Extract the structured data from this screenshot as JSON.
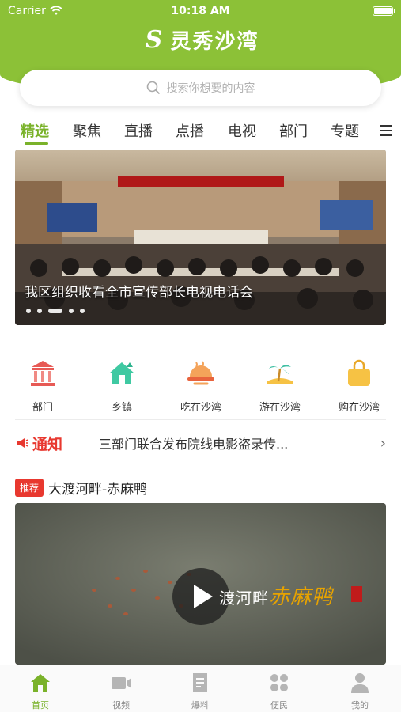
{
  "status_bar": {
    "carrier": "Carrier",
    "time": "10:18 AM"
  },
  "app": {
    "logo_text": "灵秀沙湾",
    "logo_mark": "S"
  },
  "search": {
    "placeholder": "搜索你想要的内容"
  },
  "tabs": [
    {
      "label": "精选",
      "active": true
    },
    {
      "label": "聚焦"
    },
    {
      "label": "直播"
    },
    {
      "label": "点播"
    },
    {
      "label": "电视"
    },
    {
      "label": "部门"
    },
    {
      "label": "专题"
    }
  ],
  "banner": {
    "caption": "我区组织收看全市宣传部长电视电话会",
    "slide_count": 5,
    "active_index": 2
  },
  "quick_menu": [
    {
      "label": "部门",
      "icon": "government-building-icon"
    },
    {
      "label": "乡镇",
      "icon": "township-house-icon"
    },
    {
      "label": "吃在沙湾",
      "icon": "food-dish-icon"
    },
    {
      "label": "游在沙湾",
      "icon": "palm-island-icon"
    },
    {
      "label": "购在沙湾",
      "icon": "shopping-bag-icon"
    }
  ],
  "notice": {
    "badge": "通知",
    "text": "三部门联合发布院线电影盗录传..."
  },
  "recommend": {
    "tag": "推荐",
    "title": "大渡河畔-赤麻鸭"
  },
  "video": {
    "overlay_text": "渡河畔",
    "overlay_accent": "赤麻鸭"
  },
  "bottom_nav": [
    {
      "label": "首页",
      "icon": "home-icon",
      "active": true
    },
    {
      "label": "视频",
      "icon": "video-camera-icon"
    },
    {
      "label": "爆料",
      "icon": "document-icon"
    },
    {
      "label": "便民",
      "icon": "grid-apps-icon"
    },
    {
      "label": "我的",
      "icon": "user-icon"
    }
  ],
  "colors": {
    "brand": "#8cc137",
    "active": "#7ab22a",
    "alert": "#e8382f"
  }
}
